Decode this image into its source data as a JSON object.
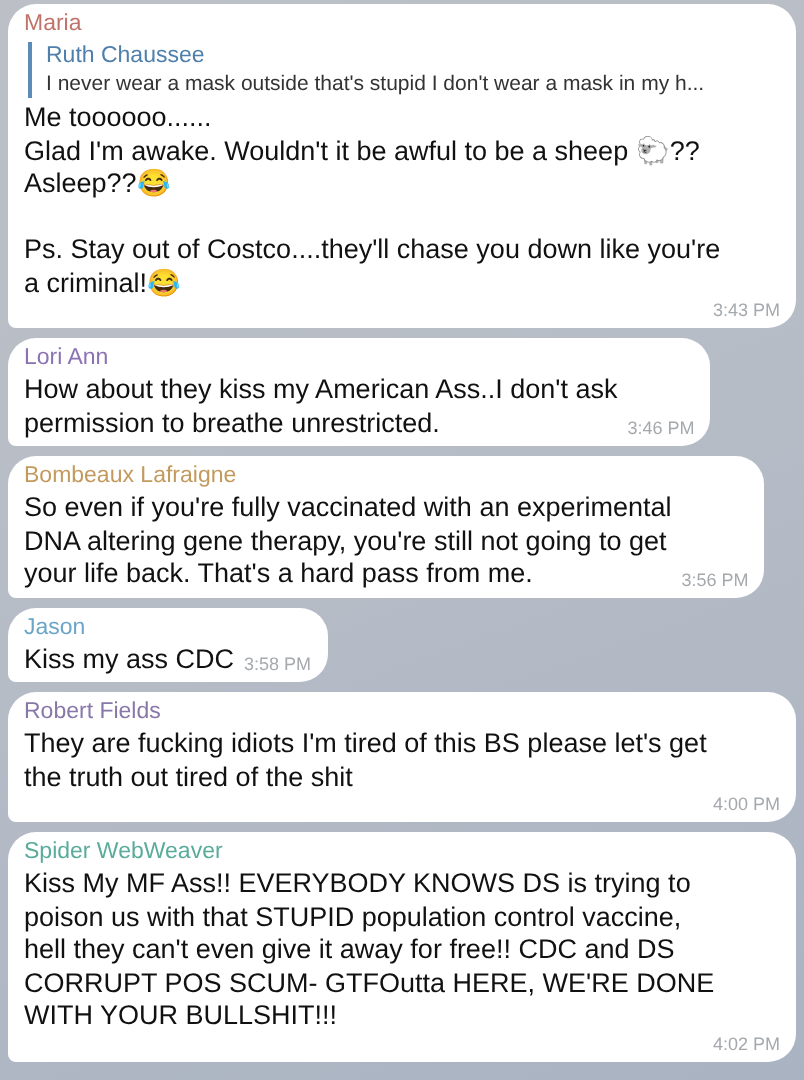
{
  "messages": [
    {
      "sender": "Maria",
      "color": "#c0736a",
      "reply": {
        "sender": "Ruth Chaussee",
        "text": "I never wear a mask outside that's stupid I don't wear a mask in my h..."
      },
      "text": "Me toooooo......\nGlad I'm awake. Wouldn't it be awful to be a sheep 🐑??\nAsleep??😂\n\nPs. Stay out of Costco....they'll chase you down like you're\na criminal!😂",
      "time": "3:43 PM"
    },
    {
      "sender": "Lori Ann",
      "color": "#8c72b3",
      "text": "How about they kiss my American Ass..I don't ask\npermission to breathe unrestricted.",
      "time": "3:46 PM"
    },
    {
      "sender": "Bombeaux Lafraigne",
      "color": "#c39a5e",
      "text": "So even if you're fully vaccinated with an experimental\nDNA altering gene therapy, you're still not going to get\nyour life back. That's a hard pass from me.",
      "time": "3:56 PM"
    },
    {
      "sender": "Jason",
      "color": "#6ba6c8",
      "text": "Kiss my ass CDC",
      "time": "3:58 PM"
    },
    {
      "sender": "Robert Fields",
      "color": "#8878a8",
      "text": "They are fucking idiots I'm tired of this BS please let's get\nthe truth out tired of the shit",
      "time": "4:00 PM"
    },
    {
      "sender": "Spider WebWeaver",
      "color": "#5aab9c",
      "text": "Kiss My MF Ass!! EVERYBODY KNOWS DS is trying to\npoison us with that STUPID population control vaccine,\nhell they can't even give it away for free!! CDC and DS\nCORRUPT POS SCUM- GTFOutta HERE, WE'RE DONE\nWITH YOUR BULLSHIT!!!",
      "time": "4:02 PM"
    }
  ]
}
